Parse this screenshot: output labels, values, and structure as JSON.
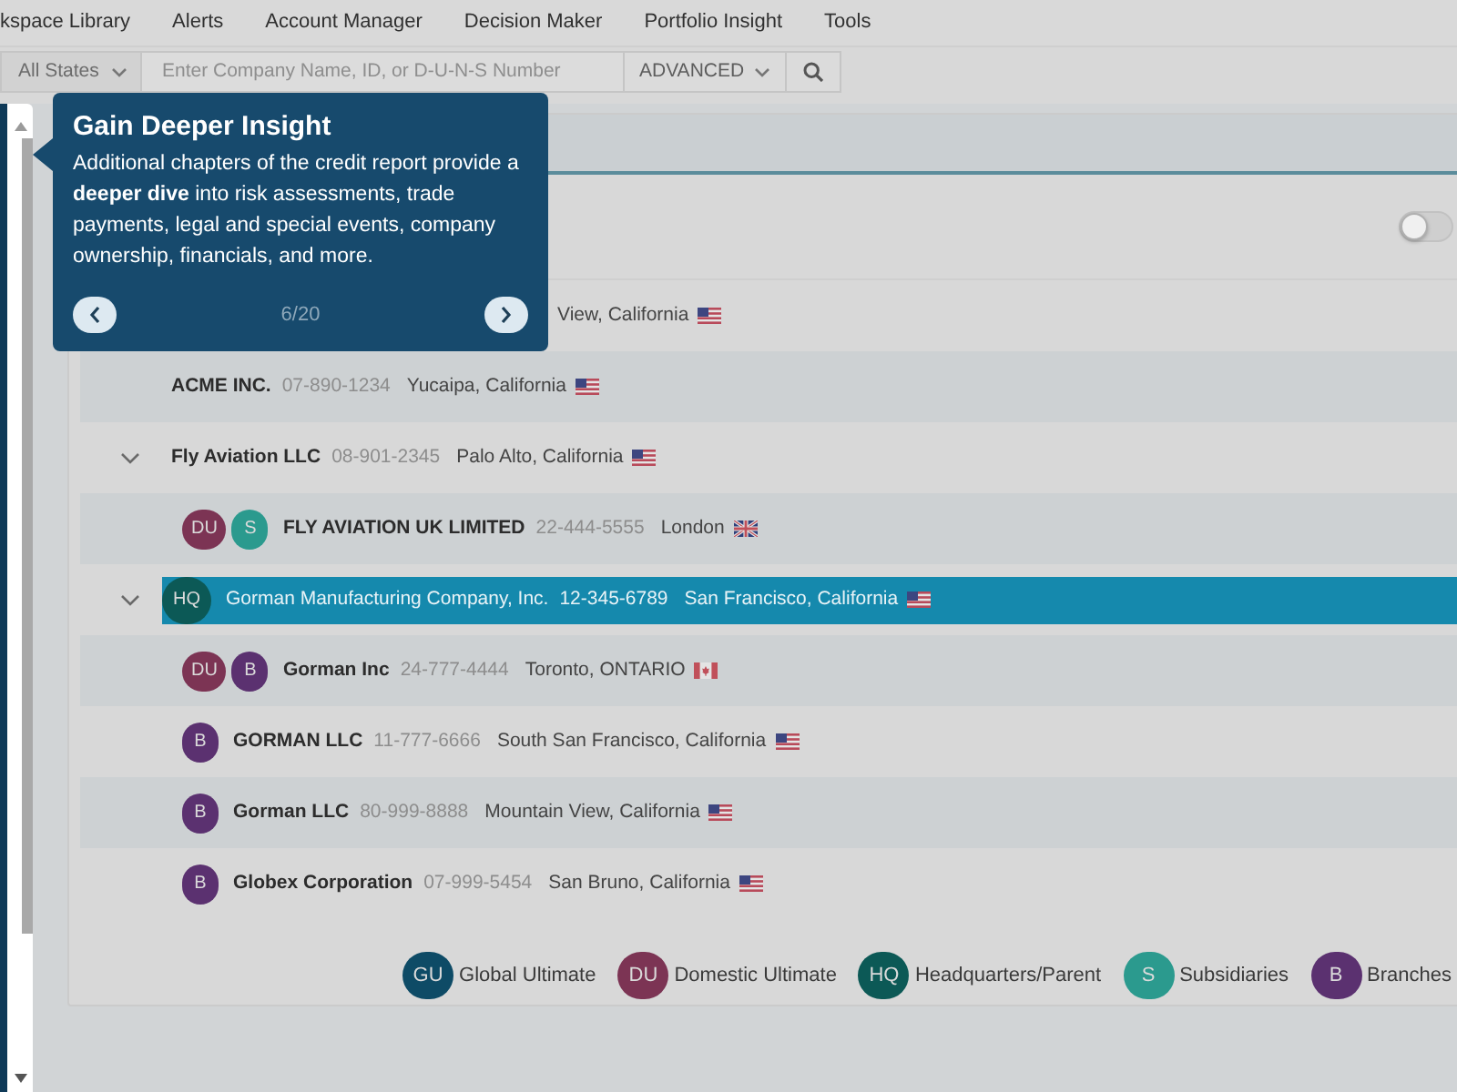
{
  "nav": {
    "items": [
      "kspace Library",
      "Alerts",
      "Account Manager",
      "Decision Maker",
      "Portfolio Insight",
      "Tools"
    ]
  },
  "search": {
    "state_filter": "All States",
    "placeholder": "Enter Company Name, ID, or D-U-N-S Number",
    "advanced": "ADVANCED"
  },
  "toggle": {
    "on": false
  },
  "tree": [
    {
      "location": "View, California",
      "flag": {
        "kind": "us"
      },
      "selected": false
    },
    {
      "name": "ACME INC.",
      "id": "07-890-1234",
      "location": "Yucaipa, California",
      "flag": {
        "kind": "us"
      },
      "selected": false
    },
    {
      "name": "Fly Aviation LLC",
      "id": "08-901-2345",
      "location": "Palo Alto, California",
      "flag": {
        "kind": "us"
      },
      "selected": false,
      "expanded": true,
      "children": [
        {
          "badges": [
            {
              "text": "DU",
              "color": "#7c3454"
            },
            {
              "text": "S",
              "color": "#2b9a8e"
            }
          ],
          "name": "FLY AVIATION UK LIMITED",
          "id": "22-444-5555",
          "location": "London",
          "flag": {
            "kind": "gb"
          },
          "selected": false
        }
      ]
    },
    {
      "badges": [
        {
          "text": "HQ",
          "color": "#0c5956"
        }
      ],
      "name": "Gorman Manufacturing Company, Inc.",
      "id": "12-345-6789",
      "location": "San Francisco, California",
      "flag": {
        "kind": "us"
      },
      "selected": true,
      "expanded": true,
      "children": [
        {
          "badges": [
            {
              "text": "DU",
              "color": "#7c3454"
            },
            {
              "text": "B",
              "color": "#5b3170"
            }
          ],
          "name": "Gorman Inc",
          "id": "24-777-4444",
          "location": "Toronto, ONTARIO",
          "flag": {
            "kind": "ca"
          },
          "selected": false
        },
        {
          "badges": [
            {
              "text": "B",
              "color": "#5b3170"
            }
          ],
          "name": "GORMAN LLC",
          "id": "11-777-6666",
          "location": "South San Francisco, California",
          "flag": {
            "kind": "us"
          },
          "selected": false
        },
        {
          "badges": [
            {
              "text": "B",
              "color": "#5b3170"
            }
          ],
          "name": "Gorman LLC",
          "id": "80-999-8888",
          "location": "Mountain View, California",
          "flag": {
            "kind": "us"
          },
          "selected": false
        },
        {
          "badges": [
            {
              "text": "B",
              "color": "#5b3170"
            }
          ],
          "name": "Globex Corporation",
          "id": "07-999-5454",
          "location": "San Bruno, California",
          "flag": {
            "kind": "us"
          },
          "selected": false
        }
      ]
    }
  ],
  "legend": [
    {
      "badge": "GU",
      "label": "Global Ultimate",
      "color": "#0e4b66"
    },
    {
      "badge": "DU",
      "label": "Domestic Ultimate",
      "color": "#7c3454"
    },
    {
      "badge": "HQ",
      "label": "Headquarters/Parent",
      "color": "#0c5956"
    },
    {
      "badge": "S",
      "label": "Subsidiaries",
      "color": "#2b9a8e"
    },
    {
      "badge": "B",
      "label": "Branches",
      "color": "#5b3170"
    }
  ],
  "tour_popover": {
    "title": "Gain Deeper Insight",
    "body": "Additional chapters of the credit report provide a **deeper dive** into risk assessments, trade payments, legal and special events, company ownership, financials, and more.",
    "counter": "6/20"
  }
}
